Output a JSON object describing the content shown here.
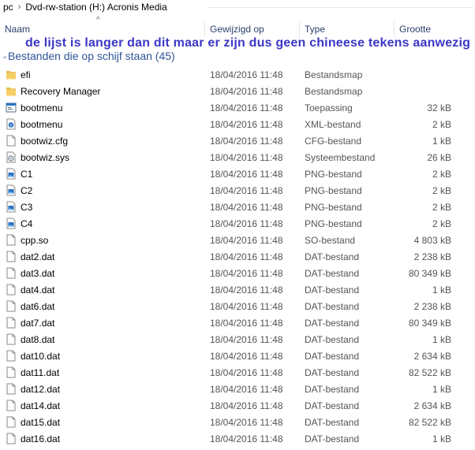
{
  "breadcrumb": {
    "items": [
      "pc",
      "Dvd-rw-station (H:) Acronis Media"
    ],
    "separator": "›"
  },
  "sort_indicator": "^",
  "columns": {
    "name": "Naam",
    "modified": "Gewijzigd op",
    "type": "Type",
    "size": "Grootte"
  },
  "annotation": "de lijst is langer dan dit maar er zijn dus geen chineese tekens aanwezig !",
  "group": {
    "title": "Bestanden die op schijf staan (45)",
    "chevron": "⌄"
  },
  "files": [
    {
      "name": "efi",
      "date": "18/04/2016 11:48",
      "type": "Bestandsmap",
      "size": "",
      "icon": "folder-icon"
    },
    {
      "name": "Recovery Manager",
      "date": "18/04/2016 11:48",
      "type": "Bestandsmap",
      "size": "",
      "icon": "folder-icon"
    },
    {
      "name": "bootmenu",
      "date": "18/04/2016 11:48",
      "type": "Toepassing",
      "size": "32 kB",
      "icon": "application-icon"
    },
    {
      "name": "bootmenu",
      "date": "18/04/2016 11:48",
      "type": "XML-bestand",
      "size": "2 kB",
      "icon": "xml-file-icon"
    },
    {
      "name": "bootwiz.cfg",
      "date": "18/04/2016 11:48",
      "type": "CFG-bestand",
      "size": "1 kB",
      "icon": "document-icon"
    },
    {
      "name": "bootwiz.sys",
      "date": "18/04/2016 11:48",
      "type": "Systeembestand",
      "size": "26 kB",
      "icon": "system-file-icon"
    },
    {
      "name": "C1",
      "date": "18/04/2016 11:48",
      "type": "PNG-bestand",
      "size": "2 kB",
      "icon": "image-file-icon"
    },
    {
      "name": "C2",
      "date": "18/04/2016 11:48",
      "type": "PNG-bestand",
      "size": "2 kB",
      "icon": "image-file-icon"
    },
    {
      "name": "C3",
      "date": "18/04/2016 11:48",
      "type": "PNG-bestand",
      "size": "2 kB",
      "icon": "image-file-icon"
    },
    {
      "name": "C4",
      "date": "18/04/2016 11:48",
      "type": "PNG-bestand",
      "size": "2 kB",
      "icon": "image-file-icon"
    },
    {
      "name": "cpp.so",
      "date": "18/04/2016 11:48",
      "type": "SO-bestand",
      "size": "4 803 kB",
      "icon": "document-icon"
    },
    {
      "name": "dat2.dat",
      "date": "18/04/2016 11:48",
      "type": "DAT-bestand",
      "size": "2 238 kB",
      "icon": "document-icon"
    },
    {
      "name": "dat3.dat",
      "date": "18/04/2016 11:48",
      "type": "DAT-bestand",
      "size": "80 349 kB",
      "icon": "document-icon"
    },
    {
      "name": "dat4.dat",
      "date": "18/04/2016 11:48",
      "type": "DAT-bestand",
      "size": "1 kB",
      "icon": "document-icon"
    },
    {
      "name": "dat6.dat",
      "date": "18/04/2016 11:48",
      "type": "DAT-bestand",
      "size": "2 238 kB",
      "icon": "document-icon"
    },
    {
      "name": "dat7.dat",
      "date": "18/04/2016 11:48",
      "type": "DAT-bestand",
      "size": "80 349 kB",
      "icon": "document-icon"
    },
    {
      "name": "dat8.dat",
      "date": "18/04/2016 11:48",
      "type": "DAT-bestand",
      "size": "1 kB",
      "icon": "document-icon"
    },
    {
      "name": "dat10.dat",
      "date": "18/04/2016 11:48",
      "type": "DAT-bestand",
      "size": "2 634 kB",
      "icon": "document-icon"
    },
    {
      "name": "dat11.dat",
      "date": "18/04/2016 11:48",
      "type": "DAT-bestand",
      "size": "82 522 kB",
      "icon": "document-icon"
    },
    {
      "name": "dat12.dat",
      "date": "18/04/2016 11:48",
      "type": "DAT-bestand",
      "size": "1 kB",
      "icon": "document-icon"
    },
    {
      "name": "dat14.dat",
      "date": "18/04/2016 11:48",
      "type": "DAT-bestand",
      "size": "2 634 kB",
      "icon": "document-icon"
    },
    {
      "name": "dat15.dat",
      "date": "18/04/2016 11:48",
      "type": "DAT-bestand",
      "size": "82 522 kB",
      "icon": "document-icon"
    },
    {
      "name": "dat16.dat",
      "date": "18/04/2016 11:48",
      "type": "DAT-bestand",
      "size": "1 kB",
      "icon": "document-icon"
    }
  ],
  "colors": {
    "annotation": "#3b37c5",
    "group_title": "#2f5597",
    "folder": "#e8b84a",
    "image_icon": "#2a74c4"
  }
}
